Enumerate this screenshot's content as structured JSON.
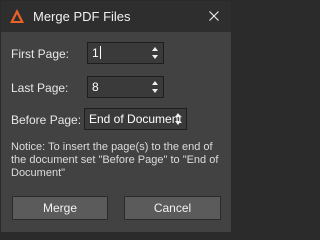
{
  "window": {
    "title": "Merge PDF Files",
    "app_icon": "pdf-app-icon",
    "close_icon": "close-icon"
  },
  "fields": {
    "first_page": {
      "label": "First Page:",
      "value": "1"
    },
    "last_page": {
      "label": "Last Page:",
      "value": "8"
    },
    "before_page": {
      "label": "Before Page:",
      "value": "End of Document"
    }
  },
  "notice": "Notice: To insert the page(s) to the end of the document set \"Before Page\" to \"End of Document\"",
  "buttons": {
    "merge": "Merge",
    "cancel": "Cancel"
  },
  "colors": {
    "accent": "#e8622a",
    "background": "#424242",
    "titlebar": "#2e2e2e",
    "button": "#5b5b5b"
  }
}
